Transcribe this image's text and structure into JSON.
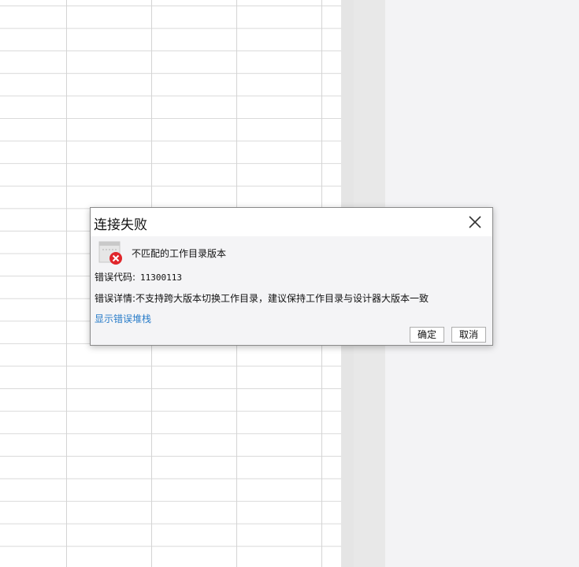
{
  "dialog": {
    "title": "连接失败",
    "message": "不匹配的工作目录版本",
    "error_code_label": "错误代码:",
    "error_code_value": "11300113",
    "error_detail_label": "错误详情:",
    "error_detail_value": "不支持跨大版本切换工作目录，建议保持工作目录与设计器大版本一致",
    "show_stack_link": "显示错误堆栈",
    "ok_button": "确定",
    "cancel_button": "取消"
  },
  "icons": {
    "close": "close-icon",
    "error": "error-icon"
  },
  "colors": {
    "link": "#2a7dc9",
    "error_red": "#e0262b",
    "dialog_bg": "#f4f4f6"
  }
}
